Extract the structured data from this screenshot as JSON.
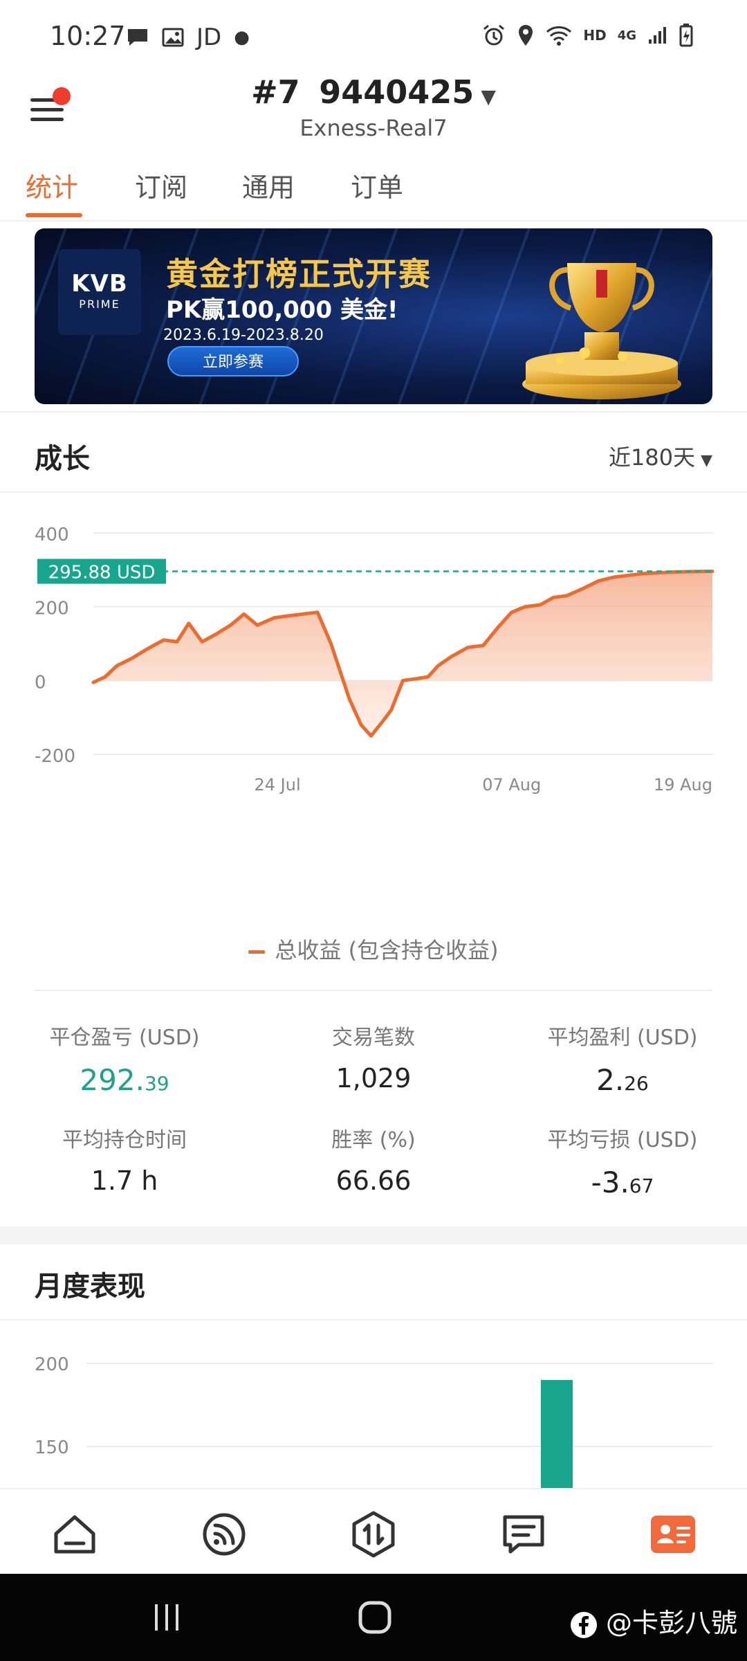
{
  "status_bar": {
    "time": "10:27",
    "left_label": "JD",
    "net_label": "HD",
    "gen_label": "4G"
  },
  "header": {
    "account_number": "#7   9440425",
    "account_server": "Exness-Real7"
  },
  "tabs": [
    {
      "label": "统计",
      "active": true
    },
    {
      "label": "订阅",
      "active": false
    },
    {
      "label": "通用",
      "active": false
    },
    {
      "label": "订单",
      "active": false
    }
  ],
  "banner": {
    "logo_main": "KVB",
    "logo_sub": "PRIME",
    "title": "黄金打榜正式开赛",
    "subtitle": "PK赢100,000 美金!",
    "dates": "2023.6.19-2023.8.20",
    "button_label": "立即参赛"
  },
  "growth": {
    "title": "成长",
    "range": "近180天"
  },
  "chart_data": [
    {
      "type": "area",
      "title": "",
      "xlabel": "",
      "ylabel": "",
      "ylim": [
        -200,
        400
      ],
      "yticks": [
        "400",
        "200",
        "0",
        "-200"
      ],
      "ytick_values": [
        400,
        200,
        0,
        -200
      ],
      "xticks": [
        {
          "label": "24 Jul",
          "x": 11
        },
        {
          "label": "07 Aug",
          "x": 25
        },
        {
          "label": "19 Aug",
          "x": 37
        }
      ],
      "xlim": [
        0,
        37
      ],
      "current_value_label": "295.88 USD",
      "current_value": 295.88,
      "grid": true,
      "series": [
        {
          "name": "总收益 (包含持仓收益)",
          "color": "#ec6b2d",
          "x": [
            0,
            0.7,
            1.4,
            2.3,
            3.2,
            4.2,
            5.0,
            5.7,
            6.5,
            7.3,
            8.2,
            9.0,
            9.8,
            10.8,
            11.6,
            12.5,
            13.4,
            14.2,
            15.3,
            16.0,
            16.6,
            17.3,
            17.8,
            18.5,
            19.3,
            20.0,
            20.6,
            21.4,
            22.4,
            23.3,
            24.2,
            25.0,
            25.8,
            26.7,
            27.5,
            28.3,
            29.3,
            30.2,
            31.1,
            32.0,
            32.9,
            33.8,
            34.7,
            35.6,
            36.3,
            37.0
          ],
          "values": [
            -5,
            10,
            40,
            60,
            85,
            110,
            105,
            155,
            105,
            125,
            150,
            180,
            150,
            170,
            175,
            180,
            185,
            100,
            -50,
            -120,
            -150,
            -110,
            -80,
            0,
            5,
            10,
            40,
            65,
            90,
            95,
            145,
            185,
            200,
            205,
            225,
            230,
            250,
            270,
            280,
            285,
            290,
            292,
            294,
            295,
            295.5,
            295.88
          ]
        }
      ]
    },
    {
      "type": "bar",
      "title": "月度表现",
      "ylim": [
        120,
        210
      ],
      "yticks": [
        "200",
        "150"
      ],
      "ytick_values": [
        200,
        150
      ],
      "categories": [
        ""
      ],
      "series": [
        {
          "values": [
            190
          ],
          "color": "#18a58e"
        }
      ]
    }
  ],
  "legend": {
    "label": "总收益 (包含持仓收益)"
  },
  "stats": {
    "closed_pnl_label": "平仓盈亏 (USD)",
    "closed_pnl_int": "292.",
    "closed_pnl_dec": "39",
    "trades_label": "交易笔数",
    "trades_value": "1,029",
    "avg_profit_label": "平均盈利 (USD)",
    "avg_profit_int": "2.",
    "avg_profit_dec": "26",
    "avg_hold_label": "平均持仓时间",
    "avg_hold_value": "1.7 h",
    "win_rate_label": "胜率 (%)",
    "win_rate_value": "66.66",
    "avg_loss_label": "平均亏损 (USD)",
    "avg_loss_int": "-3.",
    "avg_loss_dec": "67"
  },
  "monthly": {
    "title": "月度表现"
  },
  "watermark": {
    "text": "@卡彭八號"
  },
  "colors": {
    "accent": "#ec6b2d",
    "positive": "#1aa38a",
    "banner_bg": "#0a1a44"
  }
}
